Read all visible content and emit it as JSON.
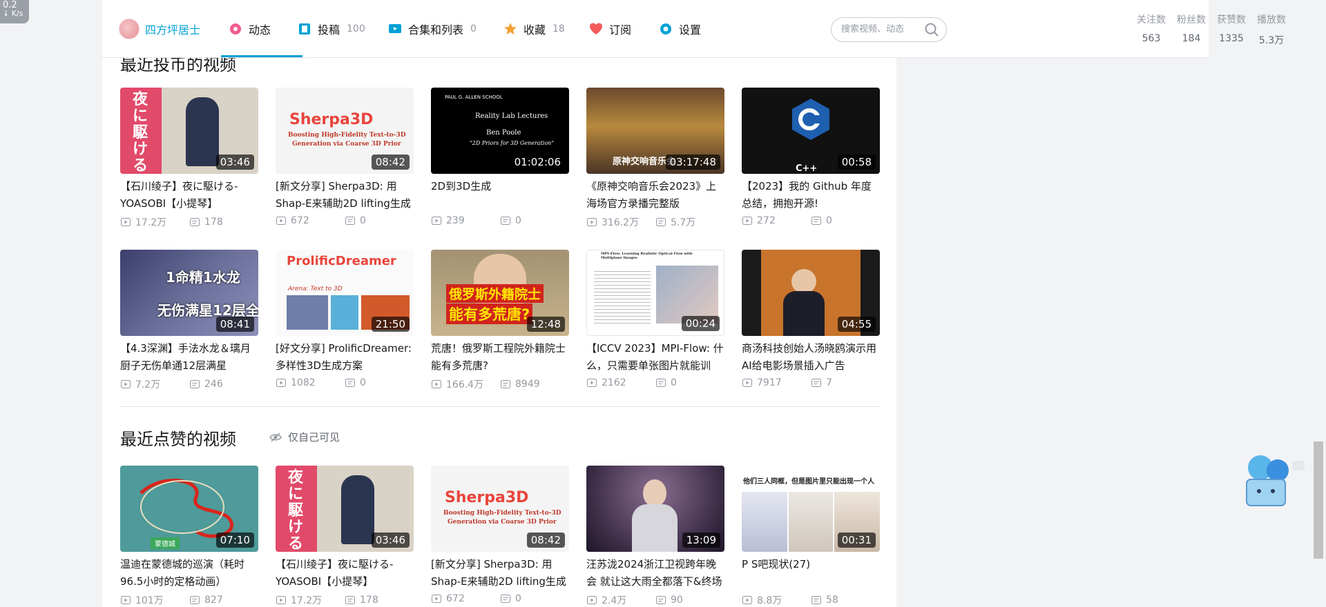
{
  "speed_widget": {
    "value": "0.2",
    "unit": "K/s"
  },
  "nav": {
    "home_label": "四方坪居士",
    "items": [
      {
        "label": "动态",
        "count": ""
      },
      {
        "label": "投稿",
        "count": "100"
      },
      {
        "label": "合集和列表",
        "count": "0"
      },
      {
        "label": "收藏",
        "count": "18"
      },
      {
        "label": "订阅",
        "count": ""
      },
      {
        "label": "设置",
        "count": ""
      }
    ],
    "search_placeholder": "搜索视频、动态",
    "stats": [
      {
        "label": "关注数",
        "value": "563"
      },
      {
        "label": "粉丝数",
        "value": "184"
      },
      {
        "label": "获赞数",
        "value": "1335"
      },
      {
        "label": "播放数",
        "value": "5.3万"
      }
    ]
  },
  "coin_section": {
    "title": "最近投币的视频",
    "videos": [
      {
        "title": "【石川绫子】夜に駆ける-YOASOBI【小提琴】",
        "duration": "03:46",
        "plays": "17.2万",
        "danmaku": "178"
      },
      {
        "title": "[新文分享] Sherpa3D: 用Shap-E来辅助2D lifting生成",
        "duration": "08:42",
        "plays": "672",
        "danmaku": "0"
      },
      {
        "title": "2D到3D生成",
        "duration": "01:02:06",
        "plays": "239",
        "danmaku": "0"
      },
      {
        "title": "《原神交响音乐会2023》上海场官方录播完整版",
        "duration": "03:17:48",
        "plays": "316.2万",
        "danmaku": "5.7万"
      },
      {
        "title": "【2023】我的 Github 年度总结，拥抱开源!",
        "duration": "00:58",
        "plays": "272",
        "danmaku": "0"
      },
      {
        "title": "【4.3深渊】手法水龙＆璃月厨子无伤单通12层满星",
        "duration": "08:41",
        "plays": "7.2万",
        "danmaku": "246"
      },
      {
        "title": "[好文分享] ProlificDreamer: 多样性3D生成方案",
        "duration": "21:50",
        "plays": "1082",
        "danmaku": "0"
      },
      {
        "title": "荒唐！俄罗斯工程院外籍院士能有多荒唐?",
        "duration": "12:48",
        "plays": "166.4万",
        "danmaku": "8949"
      },
      {
        "title": "【ICCV 2023】MPI-Flow: 什么，只需要单张图片就能训",
        "duration": "00:24",
        "plays": "2162",
        "danmaku": "0"
      },
      {
        "title": "商汤科技创始人汤晓鸥演示用AI给电影场景插入广告",
        "duration": "04:55",
        "plays": "7917",
        "danmaku": "7"
      }
    ]
  },
  "like_section": {
    "title": "最近点赞的视频",
    "note": "仅自己可见",
    "videos": [
      {
        "title": "温迪在蒙德城的巡演（耗时96.5小时的定格动画）",
        "duration": "07:10",
        "plays": "101万",
        "danmaku": "827"
      },
      {
        "title": "【石川绫子】夜に駆ける-YOASOBI【小提琴】",
        "duration": "03:46",
        "plays": "17.2万",
        "danmaku": "178"
      },
      {
        "title": "[新文分享] Sherpa3D: 用Shap-E来辅助2D lifting生成",
        "duration": "08:42",
        "plays": "672",
        "danmaku": "0"
      },
      {
        "title": "汪苏泷2024浙江卫视跨年晚会 就让这大雨全都落下&终场",
        "duration": "13:09",
        "plays": "2.4万",
        "danmaku": "90"
      },
      {
        "title": "P S吧现状(27)",
        "duration": "00:31",
        "plays": "8.8万",
        "danmaku": "58"
      }
    ]
  },
  "thumb_text": {
    "yoru": "夜に駆ける",
    "sherpa_title": "Sherpa3D",
    "sherpa_sub1": "Boosting High-Fidelity Text-to-3D",
    "sherpa_sub2": "Generation via Coarse 3D Prior",
    "lecture_school": "PAUL G. ALLEN SCHOOL",
    "lecture_title": "Reality Lab Lectures",
    "lecture_name": "Ben Poole",
    "lecture_topic": "\"2D Priors for 3D Generation\"",
    "genshin_caption": "原神交响音乐会",
    "cpp": "C++",
    "abyss_1": "1命精1水龙",
    "abyss_2": "无伤满星12层全",
    "prolific_title": "ProlificDreamer",
    "prolific_sub": "Arena: Text to 3D",
    "russia_1": "俄罗斯外籍院士",
    "russia_2": "能有多荒唐?",
    "mpi_title": "MPI-Flow: Learning Realistic Optical Flow with Multiplane Images",
    "ps_caption": "他们三人同框，但是图片里只能出现一个人",
    "map_badge": "蒙德城"
  },
  "colors": {
    "accent": "#00a1d6",
    "text": "#18191c",
    "muted": "#9499a0"
  }
}
